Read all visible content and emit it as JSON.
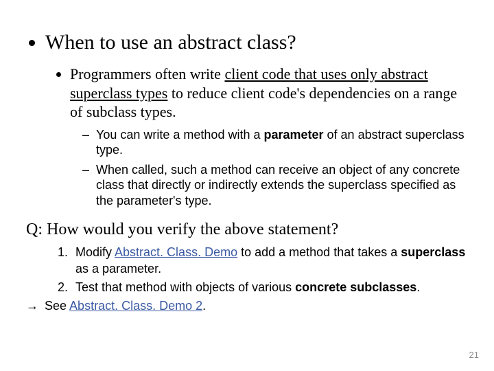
{
  "bullet1": {
    "title": "When to use an abstract class?",
    "sub1_pre": "Programmers often write ",
    "sub1_uline": "client code that uses only abstract superclass types",
    "sub1_post": " to reduce client code's dependencies on a range of subclass types.",
    "dash1_pre": "You can write a method with a ",
    "dash1_b": "parameter",
    "dash1_post": " of an abstract superclass type.",
    "dash2": "When called, such a method can receive an object of any concrete class that directly or indirectly extends the superclass specified as the parameter's type."
  },
  "question": {
    "line": "Q: How would you verify the above statement?",
    "item1_pre": "Modify ",
    "item1_link": "Abstract. Class. Demo",
    "item1_mid": " to add a method that takes a ",
    "item1_b": "superclass",
    "item1_post": " as a parameter.",
    "item2_pre": "Test that method with objects of various ",
    "item2_b": "concrete subclasses",
    "item2_post": ".",
    "see_arrow": "→",
    "see_pre": " See ",
    "see_link": "Abstract. Class. Demo 2",
    "see_post": "."
  },
  "page": "21"
}
